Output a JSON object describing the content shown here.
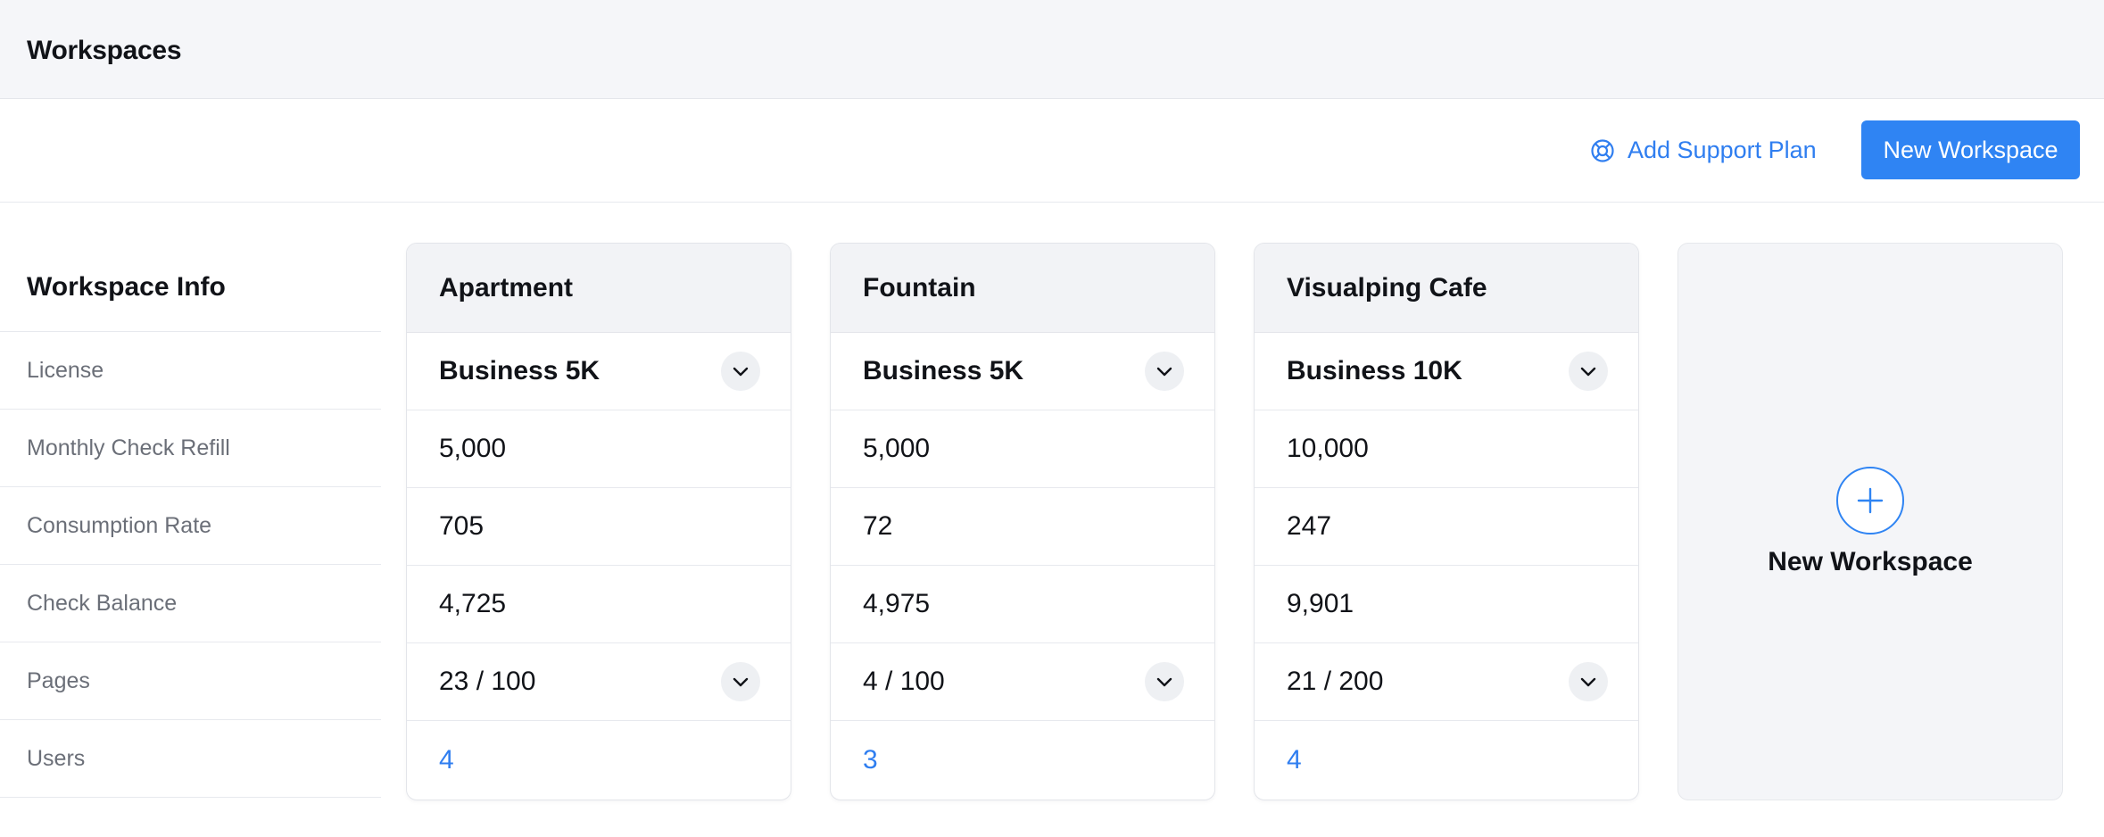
{
  "header": {
    "title": "Workspaces"
  },
  "actions": {
    "support_label": "Add Support Plan",
    "support_icon": "lifebuoy-icon",
    "new_workspace_label": "New Workspace"
  },
  "colors": {
    "accent": "#2f84f3",
    "link": "#2f7ef0",
    "header_bg": "#f5f6f9"
  },
  "info": {
    "heading": "Workspace Info",
    "rows": [
      "License",
      "Monthly Check Refill",
      "Consumption Rate",
      "Check Balance",
      "Pages",
      "Users"
    ]
  },
  "workspaces": [
    {
      "name": "Apartment",
      "license": "Business 5K",
      "refill": "5,000",
      "consumption": "705",
      "balance": "4,725",
      "pages": "23 / 100",
      "users": "4"
    },
    {
      "name": "Fountain",
      "license": "Business 5K",
      "refill": "5,000",
      "consumption": "72",
      "balance": "4,975",
      "pages": "4 / 100",
      "users": "3"
    },
    {
      "name": "Visualping Cafe",
      "license": "Business 10K",
      "refill": "10,000",
      "consumption": "247",
      "balance": "9,901",
      "pages": "21 / 200",
      "users": "4"
    }
  ],
  "new_card": {
    "label": "New Workspace"
  }
}
